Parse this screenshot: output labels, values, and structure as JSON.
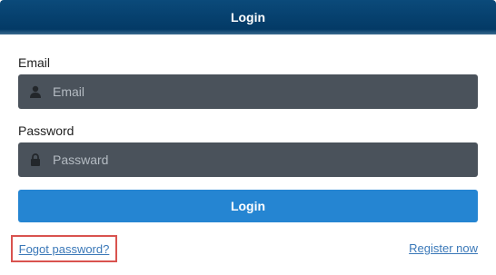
{
  "header": {
    "title": "Login"
  },
  "form": {
    "email_label": "Email",
    "email_placeholder": "Email",
    "email_icon": "user-icon",
    "password_label": "Password",
    "password_placeholder": "Passward",
    "password_icon": "lock-icon",
    "submit_label": "Login"
  },
  "links": {
    "forgot_password": "Fogot password?",
    "register": "Register now"
  },
  "colors": {
    "header": "#033a66",
    "input_background": "#4a525b",
    "button": "#2585d2",
    "link": "#3a78b8",
    "highlight_border": "#d9534f"
  }
}
